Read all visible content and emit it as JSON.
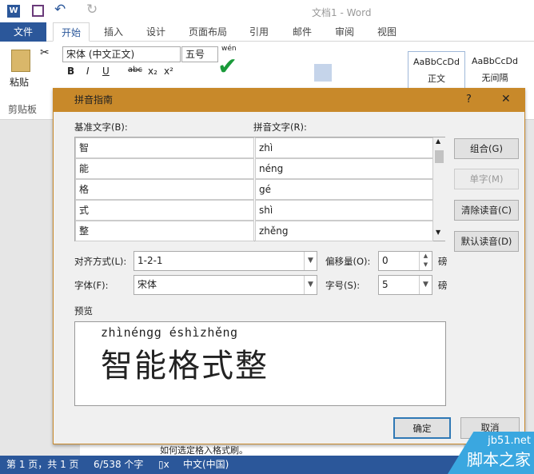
{
  "window": {
    "title": "文档1 - Word"
  },
  "qat": {
    "word_icon": "W",
    "undo": "↶",
    "redo": "↻"
  },
  "tabs": [
    "文件",
    "开始",
    "插入",
    "设计",
    "页面布局",
    "引用",
    "邮件",
    "审阅",
    "视图"
  ],
  "ribbon": {
    "paste": "粘贴",
    "clipboard": "剪贴板",
    "font_name": "宋体 (中文正文)",
    "font_size": "五号",
    "bold": "B",
    "italic": "I",
    "underline": "U",
    "strike": "abc",
    "sub": "x₂",
    "sup": "x²",
    "phonetic": "wén",
    "style1_preview": "AaBbCcDd",
    "style1": "正文",
    "style2_preview": "AaBbCcDd",
    "style2": "无间隔"
  },
  "dialog": {
    "title": "拼音指南",
    "help": "?",
    "close": "✕",
    "base_label": "基准文字(B):",
    "ruby_label": "拼音文字(R):",
    "rows": [
      {
        "base": "智",
        "ruby": "zhì"
      },
      {
        "base": "能",
        "ruby": "néng"
      },
      {
        "base": "格",
        "ruby": "gé"
      },
      {
        "base": "式",
        "ruby": "shì"
      },
      {
        "base": "整",
        "ruby": "zhěng"
      }
    ],
    "buttons": {
      "group": "组合(G)",
      "mono": "单字(M)",
      "clear": "清除读音(C)",
      "default": "默认读音(D)",
      "ok": "确定",
      "cancel": "取消"
    },
    "align_label": "对齐方式(L):",
    "align_value": "1-2-1",
    "offset_label": "偏移量(O):",
    "offset_value": "0",
    "offset_unit": "磅",
    "font_label": "字体(F):",
    "font_value": "宋体",
    "size_label": "字号(S):",
    "size_value": "5",
    "size_unit": "磅",
    "preview_label": "预览",
    "preview_ruby": "zhìnéngg éshìzhěng",
    "preview_text": "智能格式整"
  },
  "status": {
    "page": "第 1 页，共 1 页",
    "words": "6/538 个字",
    "lang": "中文(中国)"
  },
  "doc_text": "如何选定格入格式刷。",
  "watermark": {
    "site": "jb51.net",
    "name": "脚本之家"
  }
}
